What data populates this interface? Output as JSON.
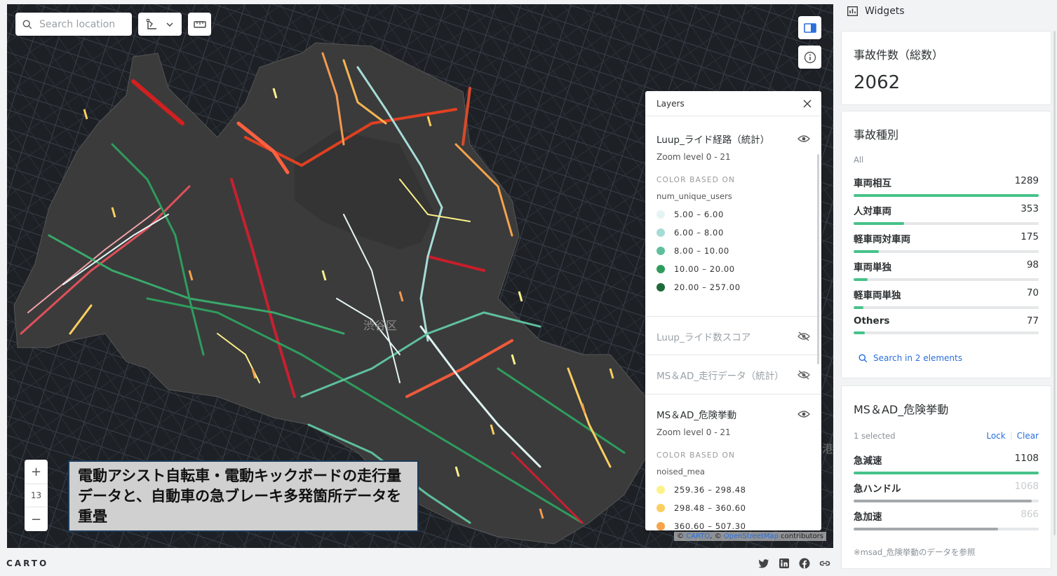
{
  "map": {
    "search_placeholder": "Search location",
    "zoom_level": "13",
    "district_label": "渋谷区",
    "edge_label": "港",
    "caption": "電動アシスト自転車・電動キックボードの走行量データと、自動車の急ブレーキ多発箇所データを重畳",
    "attribution_prefix": "© ",
    "attribution_carto": "CARTO",
    "attribution_sep": ", © ",
    "attribution_osm": "OpenStreetMap",
    "attribution_suffix": " contributors"
  },
  "layers_panel": {
    "title": "Layers",
    "layers": [
      {
        "name": "Luup_ライド経路（統計）",
        "zoom": "Zoom level 0 - 21",
        "color_based_on": "COLOR BASED ON",
        "field": "num_unique_users",
        "legend": [
          {
            "label": "5.00 – 6.00",
            "color": "#e4f4f3"
          },
          {
            "label": "6.00 – 8.00",
            "color": "#a6dcd6"
          },
          {
            "label": "8.00 – 10.00",
            "color": "#5fbf9c"
          },
          {
            "label": "10.00 – 20.00",
            "color": "#2f9c5c"
          },
          {
            "label": "20.00 – 257.00",
            "color": "#1d6a3a"
          }
        ]
      },
      {
        "name": "Luup_ライド数スコア"
      },
      {
        "name": "MS＆AD_走行データ（統計）"
      },
      {
        "name": "MS＆AD_危険挙動",
        "zoom": "Zoom level 0 - 21",
        "color_based_on": "COLOR BASED ON",
        "field": "noised_mea",
        "legend": [
          {
            "label": "259.36 – 298.48",
            "color": "#fcf28a"
          },
          {
            "label": "298.48 – 360.60",
            "color": "#fbcf5f"
          },
          {
            "label": "360.60 – 507.30",
            "color": "#f6a44a"
          }
        ]
      }
    ]
  },
  "widgets": {
    "title": "Widgets",
    "total": {
      "title": "事故件数（総数）",
      "value": "2062"
    },
    "types": {
      "title": "事故種別",
      "filter": "All",
      "items": [
        {
          "label": "車両相互",
          "value": "1289",
          "pct": 100
        },
        {
          "label": "人対車両",
          "value": "353",
          "pct": 27.4
        },
        {
          "label": "軽車両対車両",
          "value": "175",
          "pct": 13.6
        },
        {
          "label": "車両単独",
          "value": "98",
          "pct": 7.6
        },
        {
          "label": "軽車両単独",
          "value": "70",
          "pct": 5.4
        },
        {
          "label": "Others",
          "value": "77",
          "pct": 6.0
        }
      ],
      "search_link": "Search in 2 elements"
    },
    "risk": {
      "title": "MS＆AD_危険挙動",
      "selected": "1 selected",
      "lock": "Lock",
      "clear": "Clear",
      "items": [
        {
          "label": "急減速",
          "value": "1108",
          "pct": 100
        },
        {
          "label": "急ハンドル",
          "value": "1068",
          "pct": 96.4
        },
        {
          "label": "急加速",
          "value": "866",
          "pct": 78.2
        }
      ],
      "note": "※msad_危険挙動のデータを参照"
    }
  },
  "footer": {
    "logo": "CARTO"
  },
  "colors": {
    "accent": "#47c28a",
    "link": "#2a6fdb",
    "map_bg": "#1d2126",
    "district_fill": "#3d3d3d"
  }
}
